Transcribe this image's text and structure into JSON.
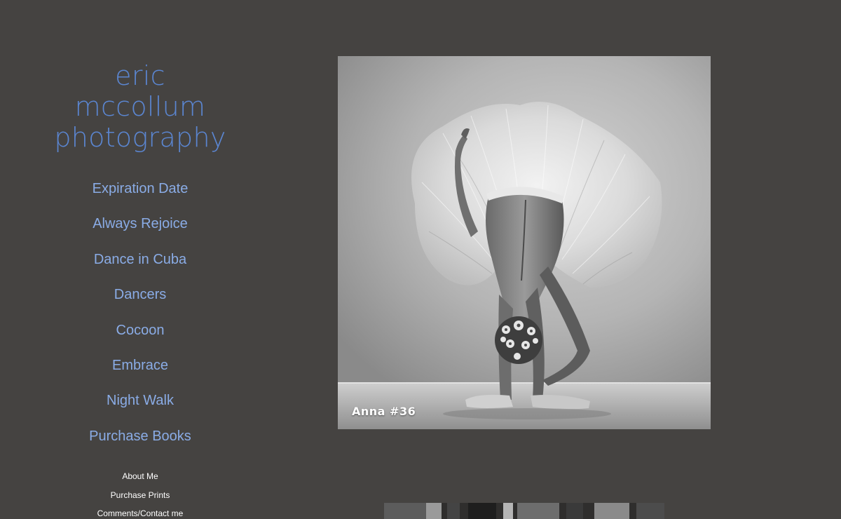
{
  "site": {
    "title_lines": [
      "eric",
      "mccollum",
      "photography"
    ],
    "title_color": "#5b86d1"
  },
  "nav": {
    "items": [
      {
        "label": "Expiration Date"
      },
      {
        "label": "Always Rejoice"
      },
      {
        "label": "Dance in Cuba"
      },
      {
        "label": "Dancers"
      },
      {
        "label": "Cocoon"
      },
      {
        "label": "Embrace"
      },
      {
        "label": "Night Walk"
      },
      {
        "label": "Purchase Books"
      }
    ],
    "link_color": "#8aace6"
  },
  "subnav": {
    "items": [
      {
        "label": "About Me"
      },
      {
        "label": "Purchase Prints"
      },
      {
        "label": "Comments/Contact me"
      }
    ]
  },
  "gallery": {
    "featured": {
      "caption": "Anna #36"
    },
    "background_color": "#454341"
  }
}
